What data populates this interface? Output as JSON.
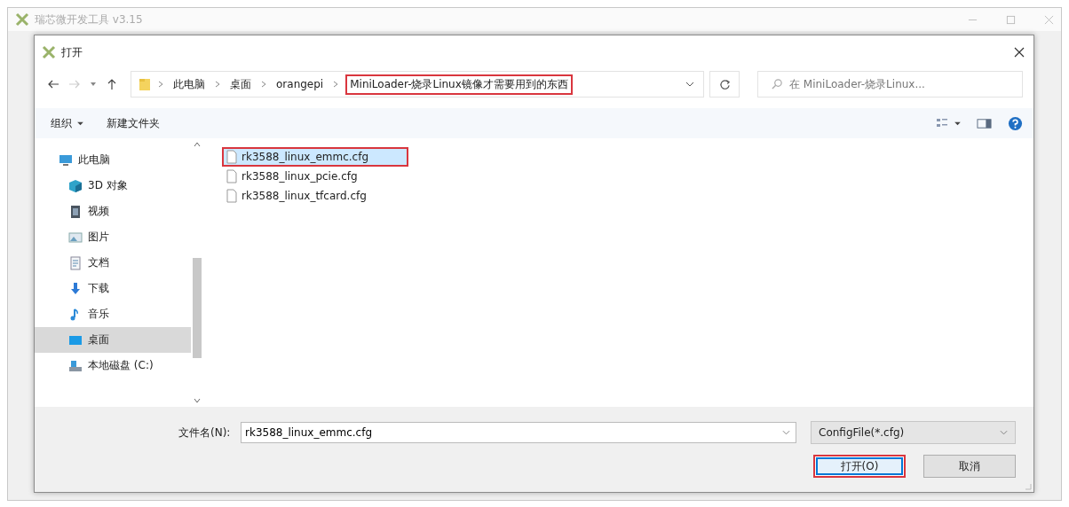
{
  "app_window": {
    "title": "瑞芯微开发工具 v3.15"
  },
  "dialog": {
    "title": "打开",
    "nav_buttons": [
      {
        "kind": "back",
        "disabled": false
      },
      {
        "kind": "forward",
        "disabled": true
      },
      {
        "kind": "recent",
        "disabled": false
      },
      {
        "kind": "up",
        "disabled": false
      }
    ],
    "breadcrumbs": [
      {
        "label": "此电脑",
        "highlighted": false
      },
      {
        "label": "桌面",
        "highlighted": false
      },
      {
        "label": "orangepi",
        "highlighted": false
      },
      {
        "label": "MiniLoader-烧录Linux镜像才需要用到的东西",
        "highlighted": true
      }
    ],
    "search": {
      "placeholder": "在 MiniLoader-烧录Linux..."
    },
    "toolbar": {
      "organize": "组织",
      "new_folder": "新建文件夹"
    },
    "sidebar": [
      {
        "label": "此电脑",
        "kind": "computer",
        "selected": false
      },
      {
        "label": "3D 对象",
        "kind": "cube",
        "selected": false
      },
      {
        "label": "视频",
        "kind": "video",
        "selected": false
      },
      {
        "label": "图片",
        "kind": "picture",
        "selected": false
      },
      {
        "label": "文档",
        "kind": "document",
        "selected": false
      },
      {
        "label": "下载",
        "kind": "download",
        "selected": false
      },
      {
        "label": "音乐",
        "kind": "music",
        "selected": false
      },
      {
        "label": "桌面",
        "kind": "desktop",
        "selected": true
      },
      {
        "label": "本地磁盘 (C:)",
        "kind": "drive",
        "selected": false
      }
    ],
    "files": [
      {
        "name": "rk3588_linux_emmc.cfg",
        "selected": true,
        "highlighted": true
      },
      {
        "name": "rk3588_linux_pcie.cfg",
        "selected": false,
        "highlighted": false
      },
      {
        "name": "rk3588_linux_tfcard.cfg",
        "selected": false,
        "highlighted": false
      }
    ],
    "filename": {
      "label": "文件名(N):",
      "value": "rk3588_linux_emmc.cfg"
    },
    "filetype": "ConfigFile(*.cfg)",
    "buttons": [
      {
        "label": "打开(O)",
        "kind": "primary",
        "highlighted": true
      },
      {
        "label": "取消",
        "kind": "secondary",
        "highlighted": false
      }
    ]
  }
}
